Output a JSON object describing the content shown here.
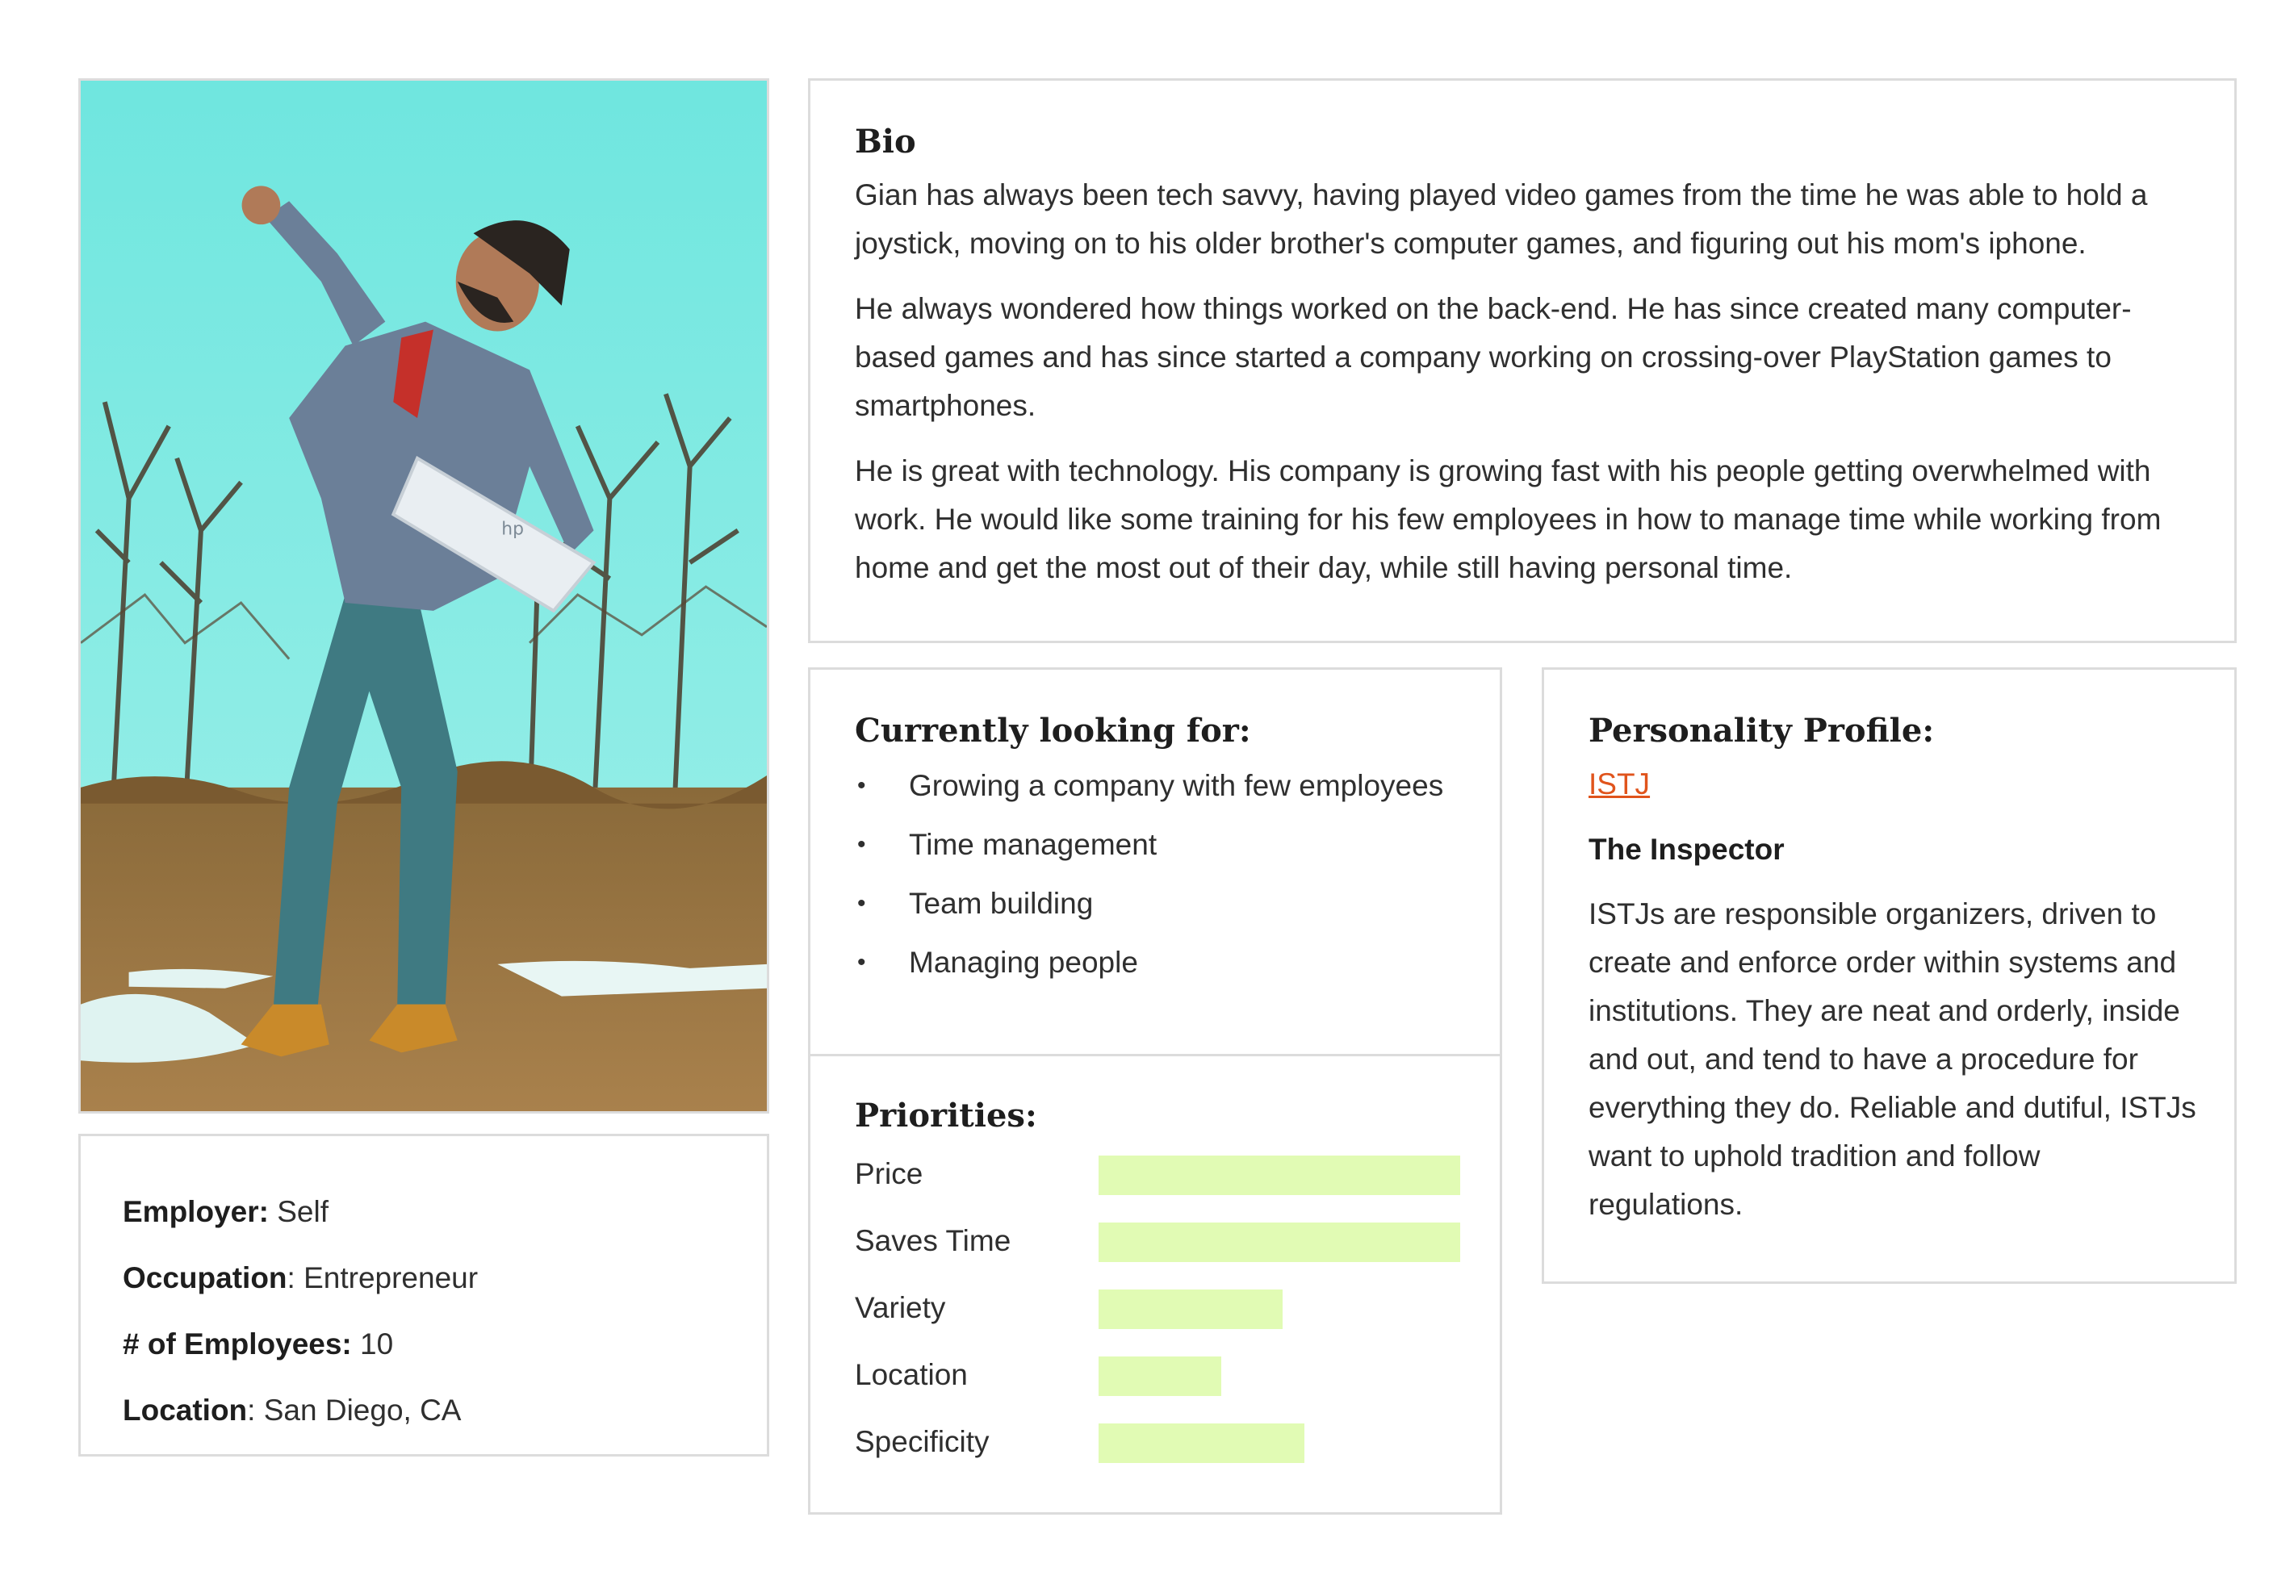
{
  "photo": {
    "alt": "Man in denim jacket holding a laptop cheering outdoors",
    "colors": {
      "sky": "#7fe8e2",
      "grass": "#a07a45"
    }
  },
  "info": {
    "employer_label": "Employer:",
    "employer_value": " Self",
    "occupation_label": "Occupation",
    "occupation_value": ": Entrepreneur",
    "employees_label": "# of Employees:",
    "employees_value": " 10",
    "location_label": "Location",
    "location_value": ": San Diego, CA"
  },
  "bio": {
    "title": "Bio",
    "paragraphs": [
      "Gian has always been tech savvy, having played video games from the time he was able to hold a joystick, moving on to his older brother's computer games, and figuring out his mom's iphone.",
      "He always wondered how things worked on the back-end. He has since created many computer-based games and has since started a company working on crossing-over PlayStation games to smartphones.",
      "He is great with technology.  His company is growing fast with his people getting overwhelmed with work. He would like some training for his few employees in how to manage time while working from home and get the most out of their day, while still having personal time."
    ]
  },
  "looking": {
    "title": "Currently looking for:",
    "bullet": "•",
    "items": [
      "Growing a company with few employees",
      "Time management",
      "Team building",
      "Managing people"
    ]
  },
  "priorities": {
    "title": "Priorities:",
    "bar_color": "#e1fbb4",
    "items": [
      {
        "label": "Price",
        "value": 1.0
      },
      {
        "label": "Saves Time",
        "value": 1.0
      },
      {
        "label": "Variety",
        "value": 0.51
      },
      {
        "label": "Location",
        "value": 0.34
      },
      {
        "label": "Specificity",
        "value": 0.57
      }
    ]
  },
  "personality": {
    "title": "Personality Profile:",
    "type_link": "ISTJ",
    "link_color": "#e0541c",
    "subtitle": "The Inspector",
    "description": "ISTJs are responsible organizers, driven to create and enforce order within systems and institutions. They are neat and orderly, inside and out, and tend to have a procedure for everything they do.  Reliable and dutiful, ISTJs want to uphold tradition and follow regulations."
  }
}
